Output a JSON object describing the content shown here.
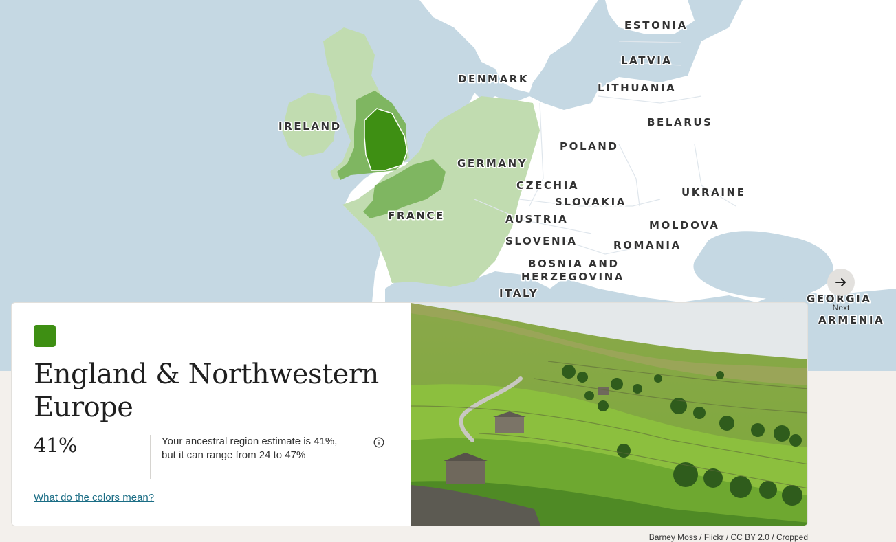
{
  "map": {
    "labels": {
      "estonia": "ESTONIA",
      "latvia": "LATVIA",
      "denmark": "DENMARK",
      "lithuania": "LITHUANIA",
      "ireland": "IRELAND",
      "belarus": "BELARUS",
      "poland": "POLAND",
      "germany": "GERMANY",
      "czechia": "CZECHIA",
      "ukraine": "UKRAINE",
      "slovakia": "SLOVAKIA",
      "france": "FRANCE",
      "austria": "AUSTRIA",
      "moldova": "MOLDOVA",
      "slovenia": "SLOVENIA",
      "romania": "ROMANIA",
      "bosnia_1": "BOSNIA AND",
      "bosnia_2": "HERZEGOVINA",
      "italy": "ITALY",
      "georgia": "GEORGIA",
      "armenia": "ARMENIA"
    },
    "colors": {
      "sea": "#c5d8e3",
      "land": "#ffffff",
      "region_light": "#c1dcb0",
      "region_mid": "#7fb661",
      "region_core": "#3e8f13"
    }
  },
  "nav": {
    "next_label": "Next",
    "next_icon": "arrow-right-icon"
  },
  "region": {
    "swatch_color": "#3e8f13",
    "title": "England & Northwestern Europe",
    "percent": "41%",
    "estimate_text": "Your ancestral region estimate is 41%, but it can range from 24 to 47%",
    "info_icon": "info-icon",
    "colors_link": "What do the colors mean?"
  },
  "photo": {
    "credit": "Barney Moss / Flickr / CC BY 2.0 / Cropped"
  }
}
